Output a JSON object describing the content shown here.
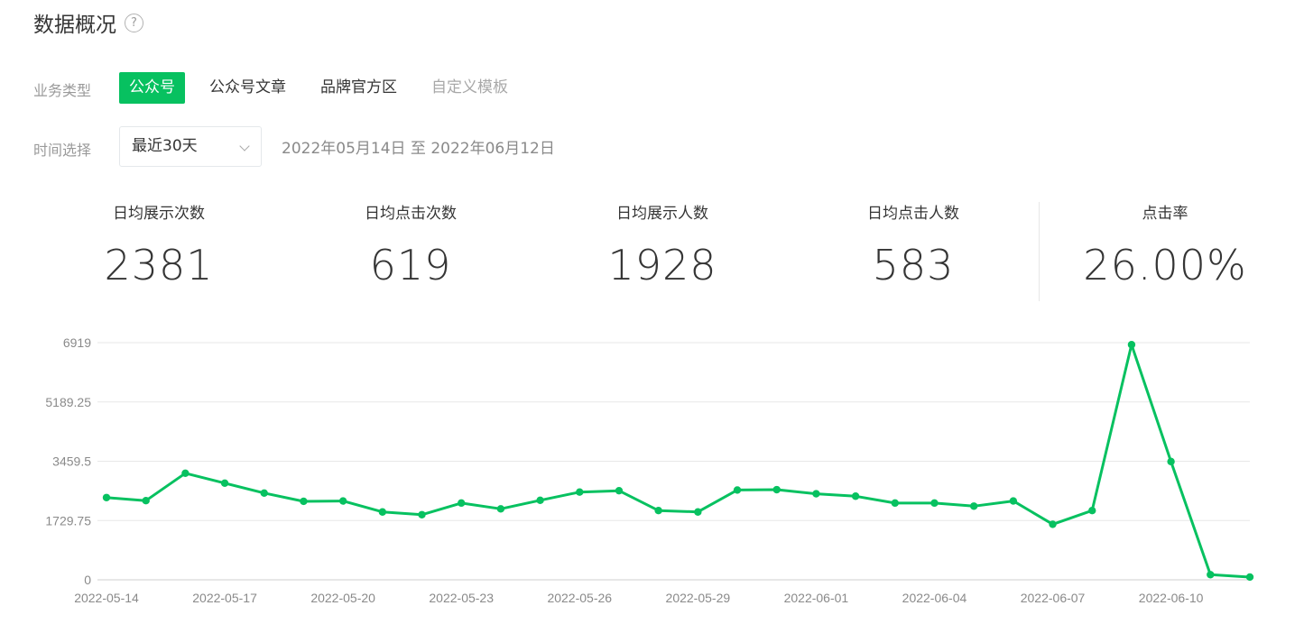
{
  "page": {
    "title": "数据概况",
    "help_icon": "question-circle-icon"
  },
  "filters": {
    "business_label": "业务类型",
    "tabs": [
      {
        "label": "公众号",
        "state": "active"
      },
      {
        "label": "公众号文章",
        "state": "normal"
      },
      {
        "label": "品牌官方区",
        "state": "normal"
      },
      {
        "label": "自定义模板",
        "state": "disabled"
      }
    ],
    "time_label": "时间选择",
    "time_select": {
      "value": "最近30天",
      "icon": "chevron-down-icon"
    },
    "date_range": "2022年05月14日 至 2022年06月12日"
  },
  "stats": [
    {
      "label": "日均展示次数",
      "value": "2381"
    },
    {
      "label": "日均点击次数",
      "value": "619"
    },
    {
      "label": "日均展示人数",
      "value": "1928"
    },
    {
      "label": "日均点击人数",
      "value": "583"
    },
    {
      "label": "点击率",
      "value": "26.00%"
    }
  ],
  "colors": {
    "accent": "#07c160",
    "grid": "#e7e7e7",
    "axis_text": "#8a8a8a"
  },
  "chart_data": {
    "type": "line",
    "x": [
      "2022-05-14",
      "2022-05-15",
      "2022-05-16",
      "2022-05-17",
      "2022-05-18",
      "2022-05-19",
      "2022-05-20",
      "2022-05-21",
      "2022-05-22",
      "2022-05-23",
      "2022-05-24",
      "2022-05-25",
      "2022-05-26",
      "2022-05-27",
      "2022-05-28",
      "2022-05-29",
      "2022-05-30",
      "2022-05-31",
      "2022-06-01",
      "2022-06-02",
      "2022-06-03",
      "2022-06-04",
      "2022-06-05",
      "2022-06-06",
      "2022-06-07",
      "2022-06-08",
      "2022-06-09",
      "2022-06-10",
      "2022-06-11",
      "2022-06-12"
    ],
    "series": [
      {
        "values": [
          2400,
          2310,
          3110,
          2820,
          2530,
          2290,
          2300,
          1980,
          1900,
          2240,
          2070,
          2320,
          2560,
          2600,
          2020,
          1980,
          2620,
          2630,
          2510,
          2440,
          2240,
          2240,
          2150,
          2300,
          1620,
          2020,
          6860,
          3450,
          150,
          80
        ]
      }
    ],
    "x_tick_labels": [
      "2022-05-14",
      "2022-05-17",
      "2022-05-20",
      "2022-05-23",
      "2022-05-26",
      "2022-05-29",
      "2022-06-01",
      "2022-06-04",
      "2022-06-07",
      "2022-06-10"
    ],
    "y_ticks": [
      "0",
      "1729.75",
      "3459.5",
      "5189.25",
      "6919"
    ],
    "ylim": [
      0,
      6919
    ],
    "grid": true,
    "legend": "none"
  }
}
